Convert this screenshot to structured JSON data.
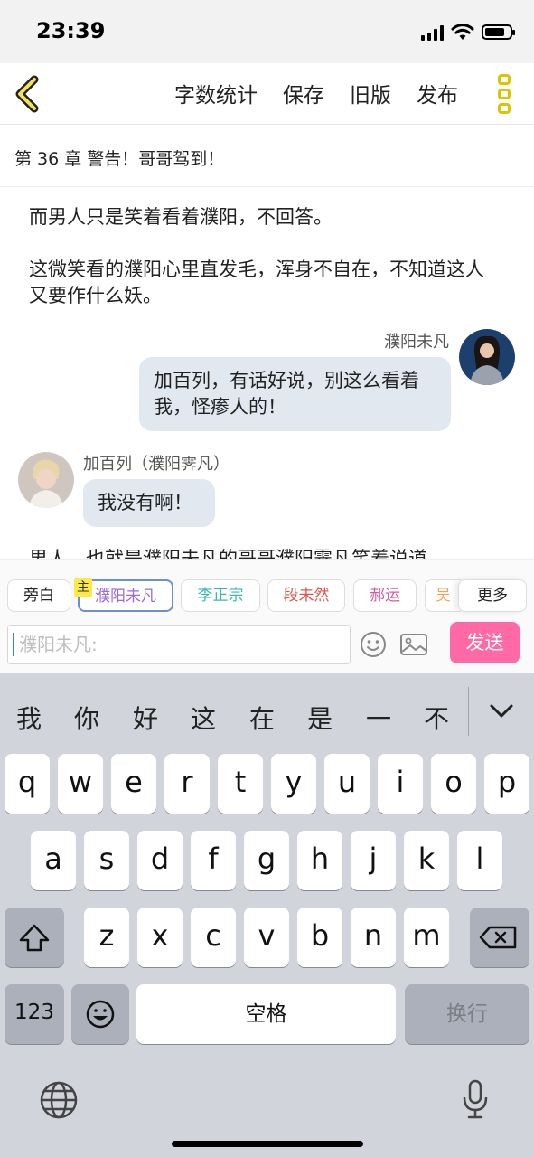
{
  "status_bar": {
    "time": "23:39",
    "battery_level": 0.8
  },
  "nav": {
    "back_icon": "chevron-left-icon",
    "actions": [
      "字数统计",
      "保存",
      "旧版",
      "发布"
    ],
    "more_icon": "more-icon"
  },
  "chapter": {
    "title": "第 36 章 警告！哥哥驾到！"
  },
  "content": {
    "para1": "而男人只是笑着看着濮阳，不回答。",
    "para2": "这微笑看的濮阳心里直发毛，浑身不自在，不知道这人又要作什么妖。",
    "msg1": {
      "speaker": "濮阳未凡",
      "text": "加百列，有话好说，别这么看着我，怪瘆人的！"
    },
    "msg2": {
      "speaker": "加百列（濮阳霁凡）",
      "text": "我没有啊！"
    },
    "para3": "男人，也就是濮阳未凡的哥哥濮阳霁凡笑着说道"
  },
  "roles": {
    "narration": "旁白",
    "main_badge": "主",
    "chips": [
      "濮阳未凡",
      "李正宗",
      "段未然",
      "郝运",
      "吴"
    ],
    "more": "更多"
  },
  "input": {
    "placeholder": "濮阳未凡:",
    "send": "发送"
  },
  "keyboard": {
    "suggestions": [
      "我",
      "你",
      "好",
      "这",
      "在",
      "是",
      "一",
      "不"
    ],
    "row1": [
      "q",
      "w",
      "e",
      "r",
      "t",
      "y",
      "u",
      "i",
      "o",
      "p"
    ],
    "row2": [
      "a",
      "s",
      "d",
      "f",
      "g",
      "h",
      "j",
      "k",
      "l"
    ],
    "row3": [
      "z",
      "x",
      "c",
      "v",
      "b",
      "n",
      "m"
    ],
    "numbers": "123",
    "space": "空格",
    "return": "换行"
  },
  "colors": {
    "accent_yellow": "#e0c200",
    "send_pink": "#ff6aa6",
    "bubble": "#e1e8ef",
    "role_colors": [
      "#9b6bd6",
      "#3ab8b0",
      "#e2554a",
      "#d85a9a",
      "#f0a35a"
    ]
  }
}
